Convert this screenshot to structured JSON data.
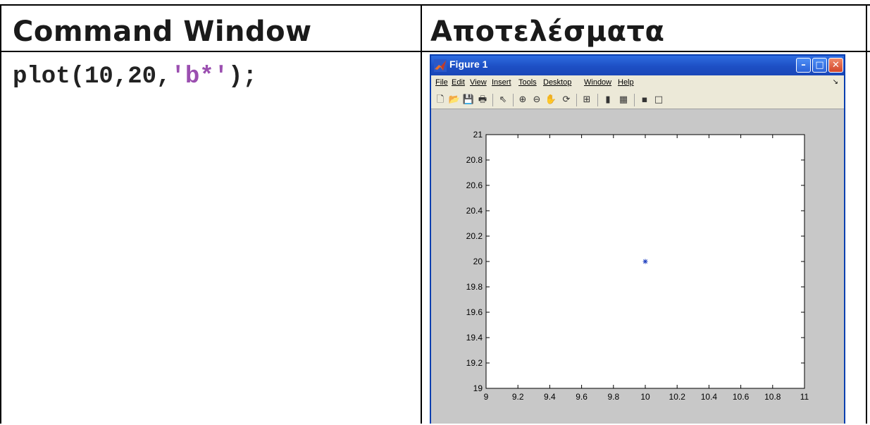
{
  "columns": {
    "left_header": "Command Window",
    "right_header": "Αποτελέσματα"
  },
  "command": {
    "prefix": "plot(10,20,",
    "string_arg": "'b*'",
    "suffix": ");"
  },
  "figure": {
    "title": "Figure 1",
    "window_buttons": {
      "minimize": "–",
      "maximize": "□",
      "close": "✕"
    },
    "menu": [
      "File",
      "Edit",
      "View",
      "Insert",
      "Tools",
      "Desktop",
      "Window",
      "Help"
    ],
    "menu_chevron": "↘",
    "toolbar_icons": [
      "new-file-icon",
      "open-folder-icon",
      "save-icon",
      "print-icon",
      "pointer-arrow-icon",
      "zoom-in-icon",
      "zoom-out-icon",
      "pan-hand-icon",
      "rotate-3d-icon",
      "data-cursor-icon",
      "colorbar-icon",
      "legend-icon",
      "hide-plot-tools-icon",
      "show-plot-tools-icon"
    ]
  },
  "chart_data": {
    "type": "scatter",
    "x": [
      10
    ],
    "y": [
      20
    ],
    "marker": "*",
    "color": "#1f3fbf",
    "xlim": [
      9,
      11
    ],
    "ylim": [
      19,
      21
    ],
    "xticks": [
      "9",
      "9.2",
      "9.4",
      "9.6",
      "9.8",
      "10",
      "10.2",
      "10.4",
      "10.6",
      "10.8",
      "11"
    ],
    "yticks": [
      "19",
      "19.2",
      "19.4",
      "19.6",
      "19.8",
      "20",
      "20.2",
      "20.4",
      "20.6",
      "20.8",
      "21"
    ],
    "title": "",
    "xlabel": "",
    "ylabel": "",
    "grid": false
  },
  "colors": {
    "string_literal": "#9b4fb0",
    "titlebar": "#1d4fc4",
    "plot_background": "#c8c8c8"
  }
}
